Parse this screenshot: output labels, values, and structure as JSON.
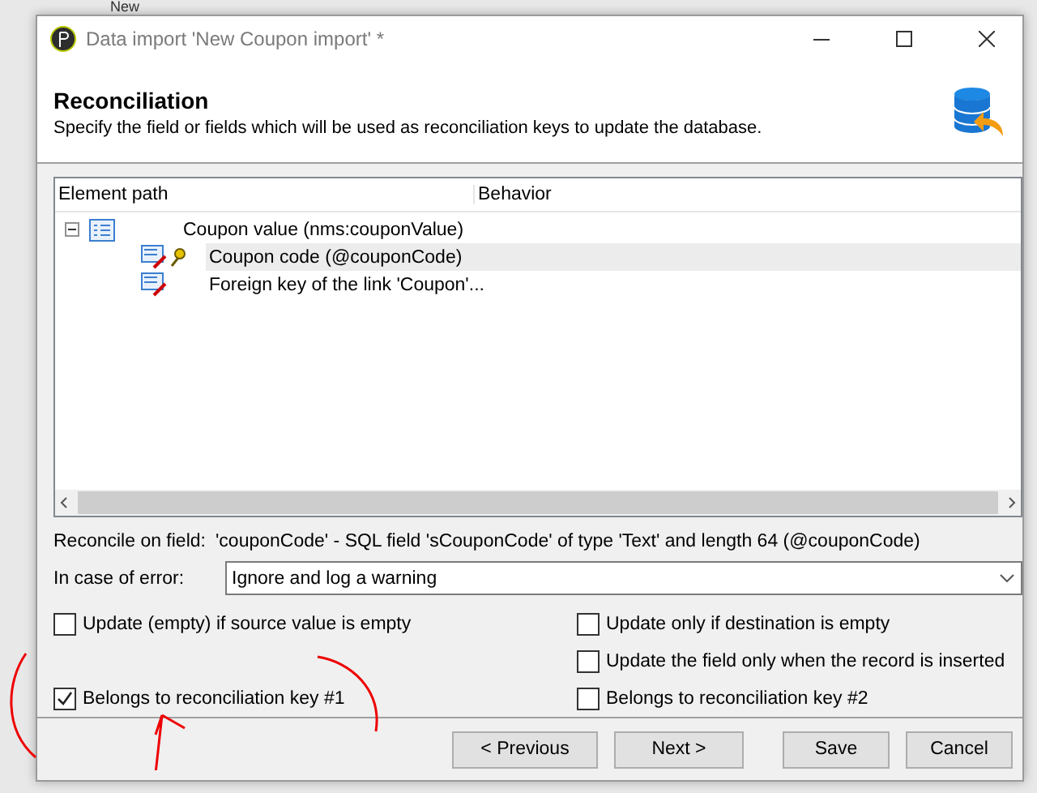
{
  "background_app": {
    "text": "New"
  },
  "window": {
    "title": "Data import 'New Coupon import' *"
  },
  "header": {
    "title": "Reconciliation",
    "description": "Specify the field or fields which will be used as reconciliation keys to update the database."
  },
  "tree": {
    "columns": [
      "Element path",
      "Behavior"
    ],
    "items": [
      {
        "label": "Coupon value (nms:couponValue)",
        "expanded": true,
        "selected": false,
        "key": false,
        "children": [
          {
            "label": "Coupon code (@couponCode)",
            "selected": true,
            "key": true
          },
          {
            "label": "Foreign key of the link 'Coupon'...",
            "selected": false,
            "key": false
          }
        ]
      }
    ]
  },
  "reconcile": {
    "label": "Reconcile on field:",
    "value": "'couponCode' - SQL field 'sCouponCode' of type 'Text' and length 64 (@couponCode)"
  },
  "error": {
    "label": "In case of error:",
    "value": "Ignore and log a warning"
  },
  "options_left": [
    {
      "label": "Update (empty) if source value is empty",
      "checked": false
    },
    {
      "label": "Belongs to reconciliation key #1",
      "checked": true
    }
  ],
  "options_right": [
    {
      "label": "Update only if destination is empty",
      "checked": false
    },
    {
      "label": "Update the field only when the record is inserted",
      "checked": false
    },
    {
      "label": "Belongs to reconciliation key #2",
      "checked": false
    }
  ],
  "buttons": [
    "< Previous",
    "Next >",
    "Save",
    "Cancel"
  ]
}
